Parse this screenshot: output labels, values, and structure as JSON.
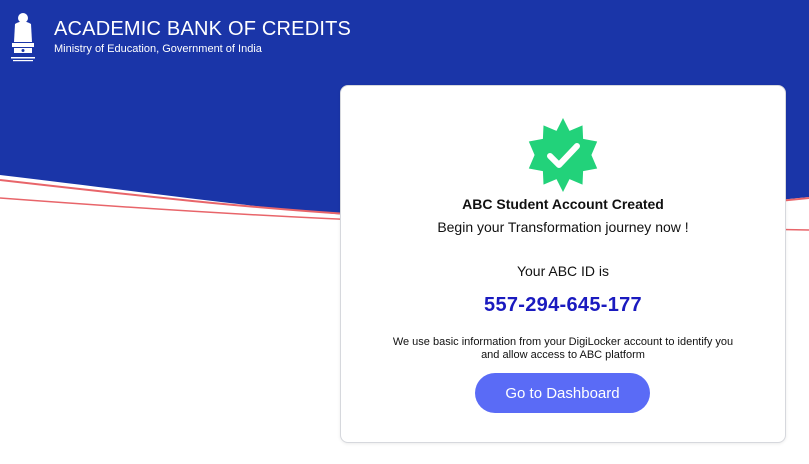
{
  "header": {
    "title": "ACADEMIC BANK OF CREDITS",
    "subtitle": "Ministry of Education, Government of India",
    "emblem_caption": "सत्यमेव जयते"
  },
  "card": {
    "title": "ABC Student Account Created",
    "subtitle": "Begin your Transformation journey now !",
    "id_label": "Your ABC ID is",
    "id_value": "557-294-645-177",
    "info": "We use basic information from your DigiLocker account to identify you and allow access to ABC platform",
    "button_label": "Go to Dashboard"
  },
  "icons": {
    "emblem": "national-emblem-icon",
    "badge": "verified-check-badge-icon"
  },
  "colors": {
    "header_blue": "#1a35a8",
    "accent_red": "#e8656a",
    "badge_green": "#22d27a",
    "id_blue": "#1a1abf",
    "button": "#5a6bf6"
  }
}
